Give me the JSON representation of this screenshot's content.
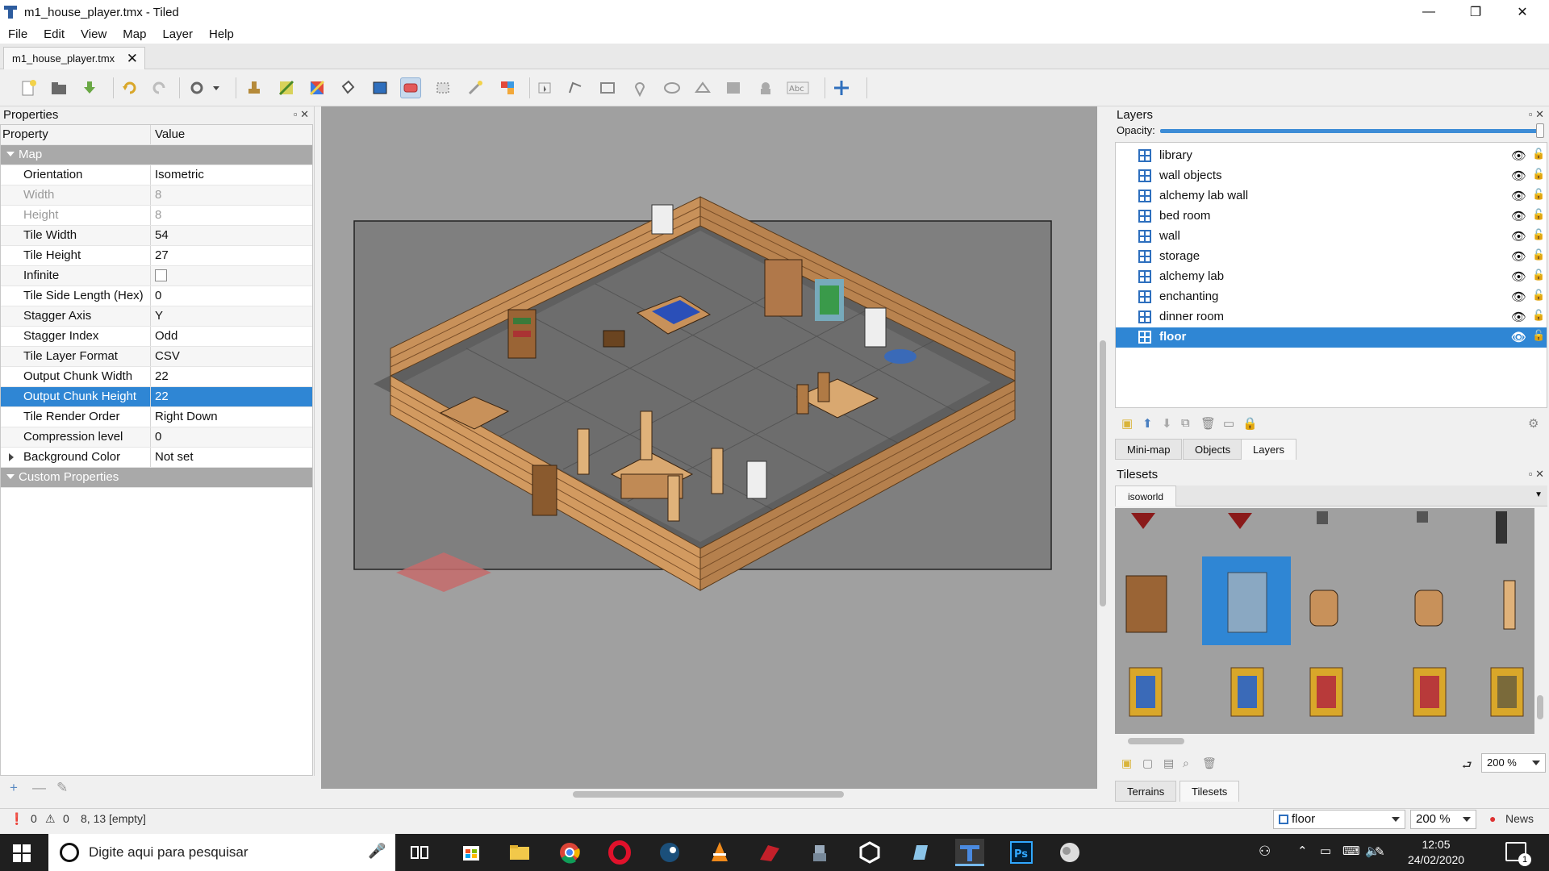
{
  "window": {
    "title": "m1_house_player.tmx - Tiled"
  },
  "menu": [
    "File",
    "Edit",
    "View",
    "Map",
    "Layer",
    "Help"
  ],
  "document_tab": {
    "label": "m1_house_player.tmx"
  },
  "toolbar_icons": [
    "new-map-icon",
    "open-icon",
    "save-icon",
    "undo-icon",
    "redo-icon",
    "commands-icon",
    "stamp-brush-icon",
    "terrain-brush-icon",
    "wang-brush-icon",
    "bucket-fill-icon",
    "shape-fill-icon",
    "eraser-icon",
    "rect-select-icon",
    "magic-wand-icon",
    "select-same-tile-icon",
    "select-objects-icon",
    "edit-polygons-icon",
    "insert-rectangle-icon",
    "insert-point-icon",
    "insert-ellipse-icon",
    "insert-polygon-icon",
    "insert-tile-icon",
    "insert-template-icon",
    "insert-text-icon",
    "random-mode-icon"
  ],
  "properties": {
    "title": "Properties",
    "col_property": "Property",
    "col_value": "Value",
    "group_map": "Map",
    "rows": [
      {
        "key": "Orientation",
        "value": "Isometric"
      },
      {
        "key": "Width",
        "value": "8"
      },
      {
        "key": "Height",
        "value": "8"
      },
      {
        "key": "Tile Width",
        "value": "54"
      },
      {
        "key": "Tile Height",
        "value": "27"
      },
      {
        "key": "Infinite",
        "value": ""
      },
      {
        "key": "Tile Side Length (Hex)",
        "value": "0"
      },
      {
        "key": "Stagger Axis",
        "value": "Y"
      },
      {
        "key": "Stagger Index",
        "value": "Odd"
      },
      {
        "key": "Tile Layer Format",
        "value": "CSV"
      },
      {
        "key": "Output Chunk Width",
        "value": "22"
      },
      {
        "key": "Output Chunk Height",
        "value": "22"
      },
      {
        "key": "Tile Render Order",
        "value": "Right Down"
      },
      {
        "key": "Compression level",
        "value": "0"
      },
      {
        "key": "Background Color",
        "value": "Not set"
      }
    ],
    "group_custom": "Custom Properties",
    "footer": {
      "add": "+",
      "remove": "—"
    }
  },
  "status": {
    "errors": "0",
    "warnings": "0",
    "position": "8, 13 [empty]",
    "layer_select": "floor",
    "zoom": "200 %",
    "news": "News"
  },
  "layers": {
    "title": "Layers",
    "opacity_label": "Opacity:",
    "opacity": 1.0,
    "items": [
      {
        "name": "library"
      },
      {
        "name": "wall objects"
      },
      {
        "name": "alchemy lab wall"
      },
      {
        "name": "bed room"
      },
      {
        "name": "wall"
      },
      {
        "name": "storage"
      },
      {
        "name": "alchemy lab"
      },
      {
        "name": "enchanting"
      },
      {
        "name": "dinner room"
      },
      {
        "name": "floor"
      }
    ],
    "selected": "floor",
    "tabs": [
      "Mini-map",
      "Objects",
      "Layers"
    ]
  },
  "tilesets": {
    "title": "Tilesets",
    "tab": "isoworld",
    "zoom": "200 %",
    "bottom_tabs": [
      "Terrains",
      "Tilesets"
    ]
  },
  "taskbar": {
    "search_placeholder": "Digite aqui para pesquisar",
    "time": "12:05",
    "date": "24/02/2020",
    "notifications": "1"
  },
  "colors": {
    "selection": "#2f86d4",
    "canvas_bg": "#a0a0a0",
    "wood": "#c8915a",
    "floor": "#6e6e6e"
  }
}
